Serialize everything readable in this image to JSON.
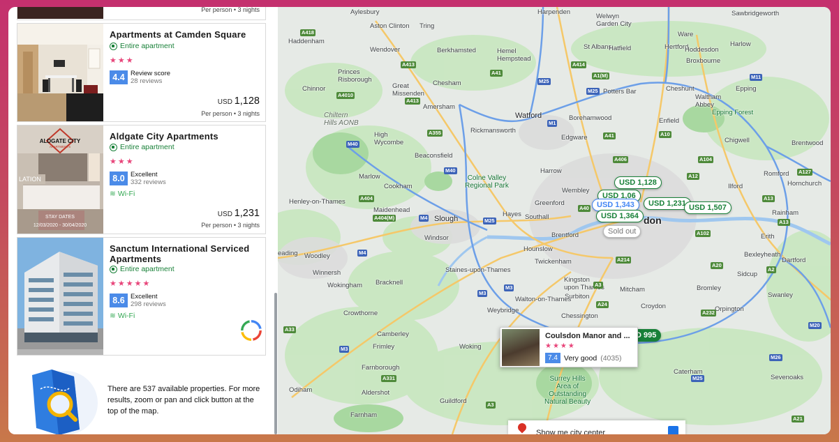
{
  "list": {
    "top_card": {
      "per_person": "Per person • 3 nights"
    },
    "properties": [
      {
        "name": "Apartments at Camden Square",
        "type": "Entire apartment",
        "stars": "★★★",
        "score": "4.4",
        "score_label": "Review score",
        "reviews": "28 reviews",
        "currency": "USD",
        "price": "1,128",
        "per_person": "Per person • 3 nights"
      },
      {
        "name": "Aldgate City Apartments",
        "type": "Entire apartment",
        "stars": "★★★",
        "score": "8.0",
        "score_label": "Excellent",
        "reviews": "332 reviews",
        "wifi": "Wi-Fi",
        "currency": "USD",
        "price": "1,231",
        "per_person": "Per person • 3 nights",
        "photo_sign": "ALDGATE CITY",
        "photo_sign_sub": "APARTMENTS",
        "photo_overlay": "STAY DATES",
        "photo_overlay_dates": "12/03/2020 - 30/04/2020",
        "photo_text_left": "LATION"
      },
      {
        "name": "Sanctum International Serviced Apartments",
        "type": "Entire apartment",
        "stars": "★★★★★",
        "score": "8.6",
        "score_label": "Excellent",
        "reviews": "298 reviews",
        "wifi": "Wi-Fi"
      }
    ],
    "info": "There are 537 available properties. For more results, zoom or pan and click button at the top of the map."
  },
  "map": {
    "places": {
      "aylesbury": "Aylesbury",
      "harpenden": "Harpenden",
      "welwyn": "Welwyn\nGarden City",
      "ware": "Ware",
      "sawbridgeworth": "Sawbridgeworth",
      "aston_clinton": "Aston Clinton",
      "tring": "Tring",
      "haddenham": "Haddenham",
      "wendover": "Wendover",
      "berkhamsted": "Berkhamsted",
      "hemel": "Hemel\nHempstead",
      "st_albans": "St Albans",
      "hatfield": "Hatfield",
      "hertford": "Hertford",
      "hoddesdon": "Hoddesdon",
      "harlow": "Harlow",
      "princes_risborough": "Princes\nRisborough",
      "broxbourne": "Broxbourne",
      "chinnor": "Chinnor",
      "great_missenden": "Great\nMissenden",
      "chesham": "Chesham",
      "potters_bar": "Potters Bar",
      "cheshunt": "Cheshunt",
      "waltham_abbey": "Waltham\nAbbey",
      "epping": "Epping",
      "chiltern": "Chiltern\nHills AONB",
      "amersham": "Amersham",
      "watford": "Watford",
      "borehamwood": "Borehamwood",
      "epping_forest": "Epping Forest",
      "enfield": "Enfield",
      "high_wycombe": "High\nWycombe",
      "rickmansworth": "Rickmansworth",
      "edgware": "Edgware",
      "chigwell": "Chigwell",
      "brentwood": "Brentwood",
      "beaconsfield": "Beaconsfield",
      "marlow": "Marlow",
      "harrow": "Harrow",
      "colne_valley": "Colne Valley\nRegional Park",
      "romford": "Romford",
      "hornchurch": "Hornchurch",
      "henley": "Henley-on-Thames",
      "cookham": "Cookham",
      "wembley": "Wembley",
      "ilford": "Ilford",
      "maidenhead": "Maidenhead",
      "greenford": "Greenford",
      "hayes": "Hayes",
      "slough": "Slough",
      "southall": "Southall",
      "london": "don",
      "rainham": "Rainham",
      "windsor": "Windsor",
      "brentford": "Brentford",
      "erith": "Erith",
      "reading": "eading",
      "woodley": "Woodley",
      "hounslow": "Hounslow",
      "twickenham": "Twickenham",
      "bexleyheath": "Bexleyheath",
      "dartford": "Dartford",
      "winnersh": "Winnersh",
      "staines": "Staines-upon-Thames",
      "kingston": "Kingston\nupon Thames",
      "bromley": "Bromley",
      "sidcup": "Sidcup",
      "wokingham": "Wokingham",
      "bracknell": "Bracknell",
      "mitcham": "Mitcham",
      "surbiton": "Surbiton",
      "swanley": "Swanley",
      "weybridge": "Weybridge",
      "walton": "Walton-on-Thames",
      "croydon": "Croydon",
      "orpington": "Orpington",
      "crowthorne": "Crowthorne",
      "chessington": "Chessington",
      "camberley": "Camberley",
      "frimley": "Frimley",
      "woking": "Woking",
      "caterham": "Caterham",
      "sevenoaks": "Sevenoaks",
      "farnborough": "Farnborough",
      "surrey_hills": "Surrey Hills\nArea of\nOutstanding\nNatural Beauty",
      "aldershot": "Aldershot",
      "odiham": "Odiham",
      "guildford": "Guildford",
      "farnham": "Farnham"
    },
    "pins": {
      "p1128": "USD 1,128",
      "p1343": "USD 1,343",
      "p1364": "USD 1,364",
      "p1231": "USD 1,231",
      "p1507": "USD 1,507",
      "p995": "D 995",
      "sold": "Sold out"
    },
    "popup": {
      "name": "Coulsdon Manor and ...",
      "stars": "★★★★",
      "score": "7.4",
      "label": "Very good",
      "count": "(4035)"
    },
    "citybar": "Show me city center"
  }
}
